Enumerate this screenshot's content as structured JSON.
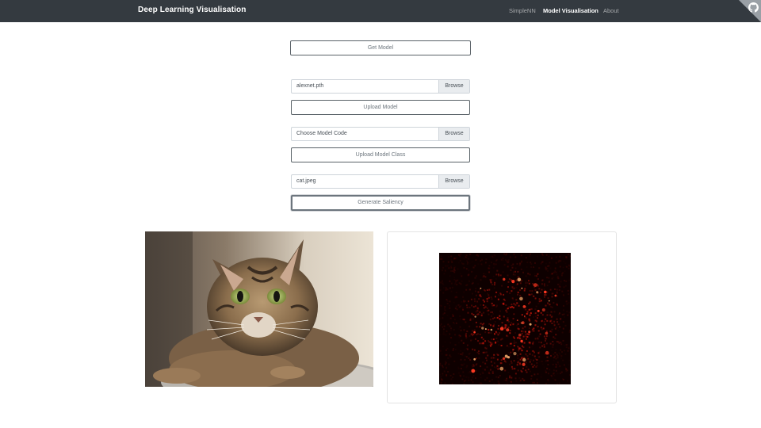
{
  "navbar": {
    "brand": "Deep Learning Visualisation",
    "links": [
      {
        "label": "SimpleNN",
        "active": false
      },
      {
        "label": "Model Visualisation",
        "active": true
      },
      {
        "label": "About",
        "active": false
      }
    ],
    "corner_icon": "github-icon"
  },
  "controls": {
    "get_model": "Get Model",
    "model_file": {
      "value": "alexnet.pth",
      "browse": "Browse"
    },
    "upload_model": "Upload Model",
    "code_file": {
      "placeholder": "Choose Model Code",
      "browse": "Browse"
    },
    "upload_class": "Upload Model Class",
    "image_file": {
      "value": "cat.jpeg",
      "browse": "Browse"
    },
    "generate": "Generate Saliency"
  },
  "results": {
    "input_image": "cat-photo",
    "saliency_image": "saliency-heatmap"
  },
  "colors": {
    "navbar": "#343a40",
    "heat_low": "#0e0000",
    "heat_high": "#ff2a1a"
  }
}
